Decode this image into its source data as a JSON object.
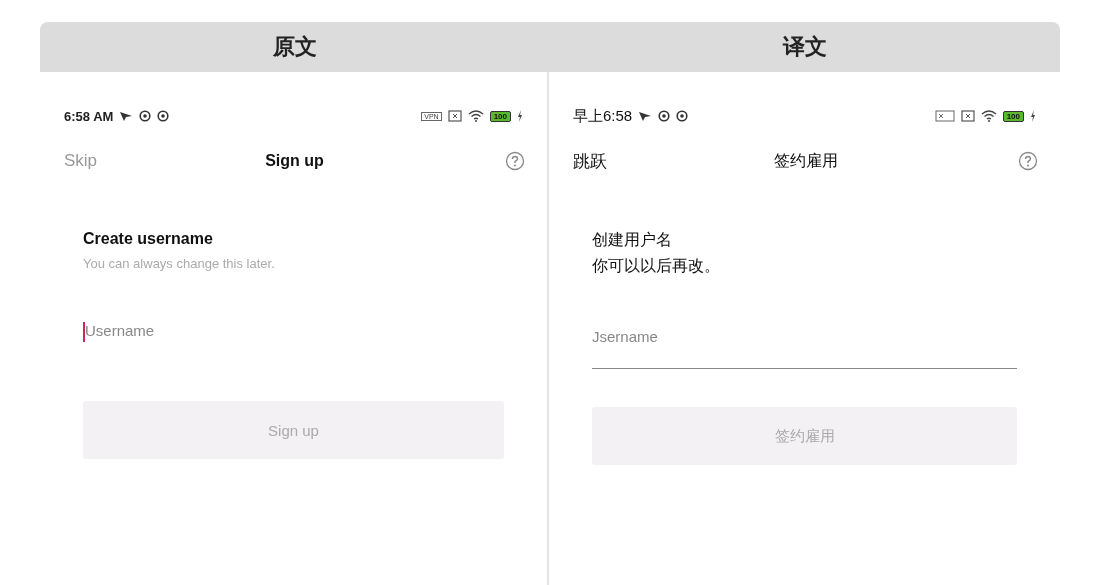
{
  "header": {
    "labels": [
      "原文",
      "译文"
    ]
  },
  "panels": [
    {
      "status_bar": {
        "time": "6:58 AM",
        "vpn": "VPN",
        "battery": "100"
      },
      "nav": {
        "left": "Skip",
        "title": "Sign up"
      },
      "heading": "Create username",
      "subtitle": "You can always change this later.",
      "field": {
        "placeholder": "Username",
        "focused": true,
        "underline": false
      },
      "button": {
        "label": "Sign up",
        "disabled": true
      }
    },
    {
      "status_bar": {
        "time": "早上6:58",
        "battery": "100"
      },
      "nav": {
        "left": "跳跃",
        "title": "签约雇用"
      },
      "heading": "创建用户名",
      "subtitle": "你可以以后再改。",
      "field": {
        "placeholder": "Jsername",
        "focused": false,
        "underline": true
      },
      "button": {
        "label": "签约雇用",
        "disabled": true
      }
    }
  ]
}
